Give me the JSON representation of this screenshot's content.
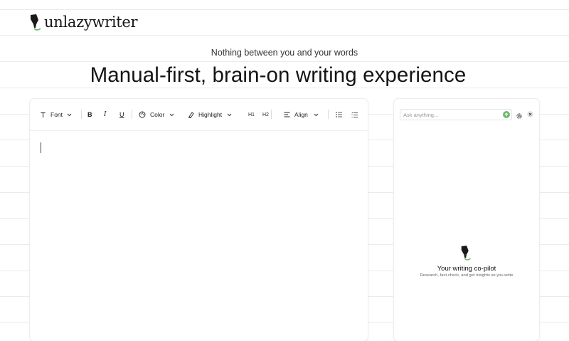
{
  "brand": {
    "name": "unlazywriter",
    "logo_icon": "pen-nib-icon"
  },
  "hero": {
    "tagline": "Nothing between you and your words",
    "headline": "Manual-first, brain-on writing experience"
  },
  "toolbar": {
    "font_label": "Font",
    "color_label": "Color",
    "highlight_label": "Highlight",
    "h1_label": "H1",
    "h2_label": "H2",
    "align_label": "Align",
    "bold_label": "B",
    "italic_label": "I",
    "underline_label": "U"
  },
  "editor": {
    "content": ""
  },
  "copilot": {
    "ask_placeholder": "Ask anything...",
    "title": "Your writing co-pilot",
    "subtitle": "Research, fact-check, and get insights as you write"
  },
  "colors": {
    "accent_green": "#6fb86f",
    "rule_line": "#ebebeb"
  }
}
